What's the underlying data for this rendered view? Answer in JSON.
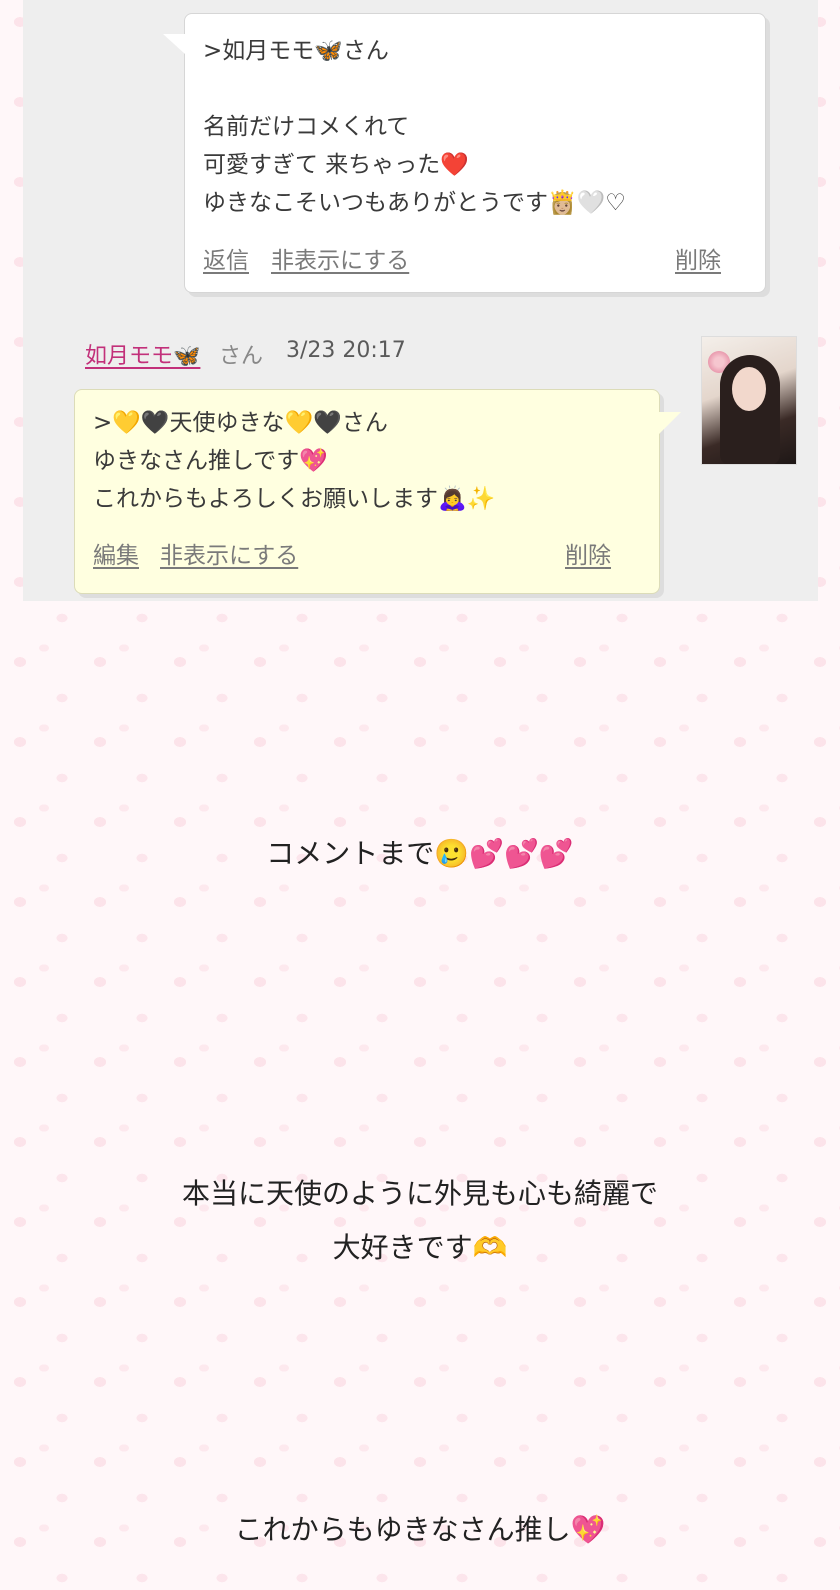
{
  "screenshot": {
    "reply_bubble": {
      "lines": [
        ">如月モモ🦋さん",
        "",
        "名前だけコメくれて",
        "可愛すぎて 来ちゃった❤️",
        "ゆきなこそいつもありがとうです👸🏼🤍♡"
      ],
      "actions": {
        "reply": "返信",
        "hide": "非表示にする",
        "delete": "削除"
      }
    },
    "comment": {
      "author_name": "如月モモ🦋",
      "author_suffix": "さん",
      "timestamp": "3/23 20:17",
      "lines": [
        ">💛🖤天使ゆきな💛🖤さん",
        "ゆきなさん推しです💖",
        "これからもよろしくお願いします🙇‍♀️✨"
      ],
      "actions": {
        "edit": "編集",
        "hide": "非表示にする",
        "delete": "削除"
      }
    }
  },
  "blog": {
    "line1": "コメントまで🥲💕💕💕",
    "line2": "本当に天使のように外見も心も綺麗で",
    "line3": "大好きです🫶",
    "line4": "これからもゆきなさん推し💖"
  },
  "colors": {
    "author_link": "#c2307a",
    "reply_bubble_bg": "#ffffff",
    "comment_bubble_bg": "#ffffe0",
    "screenshot_bg": "#eeeeee"
  }
}
